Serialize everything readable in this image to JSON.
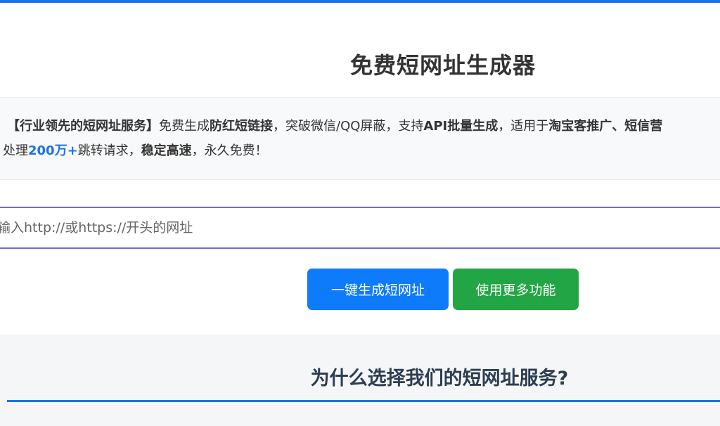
{
  "page": {
    "title": "免费短网址生成器"
  },
  "intro": {
    "l1": {
      "a": "【行业领先的短网址服务】",
      "b": "免费生成",
      "c": "防红短链接",
      "d": "，突破微信/QQ屏蔽，支持",
      "e": "API批量生成",
      "f": "，适用于",
      "g": "淘宝客推广、短信营"
    },
    "l2": {
      "a": "处理",
      "b": "200万+",
      "c": "跳转请求，",
      "d": "稳定高速",
      "e": "，永久免费！"
    }
  },
  "form": {
    "url_placeholder": "输入http://或https://开头的网址",
    "generate_label": "一键生成短网址",
    "more_label": "使用更多功能"
  },
  "features": {
    "title": "为什么选择我们的短网址服务?"
  },
  "colors": {
    "accent": "#1a73e8",
    "primary_button": "#0d7bfa",
    "success_button": "#22a544"
  }
}
